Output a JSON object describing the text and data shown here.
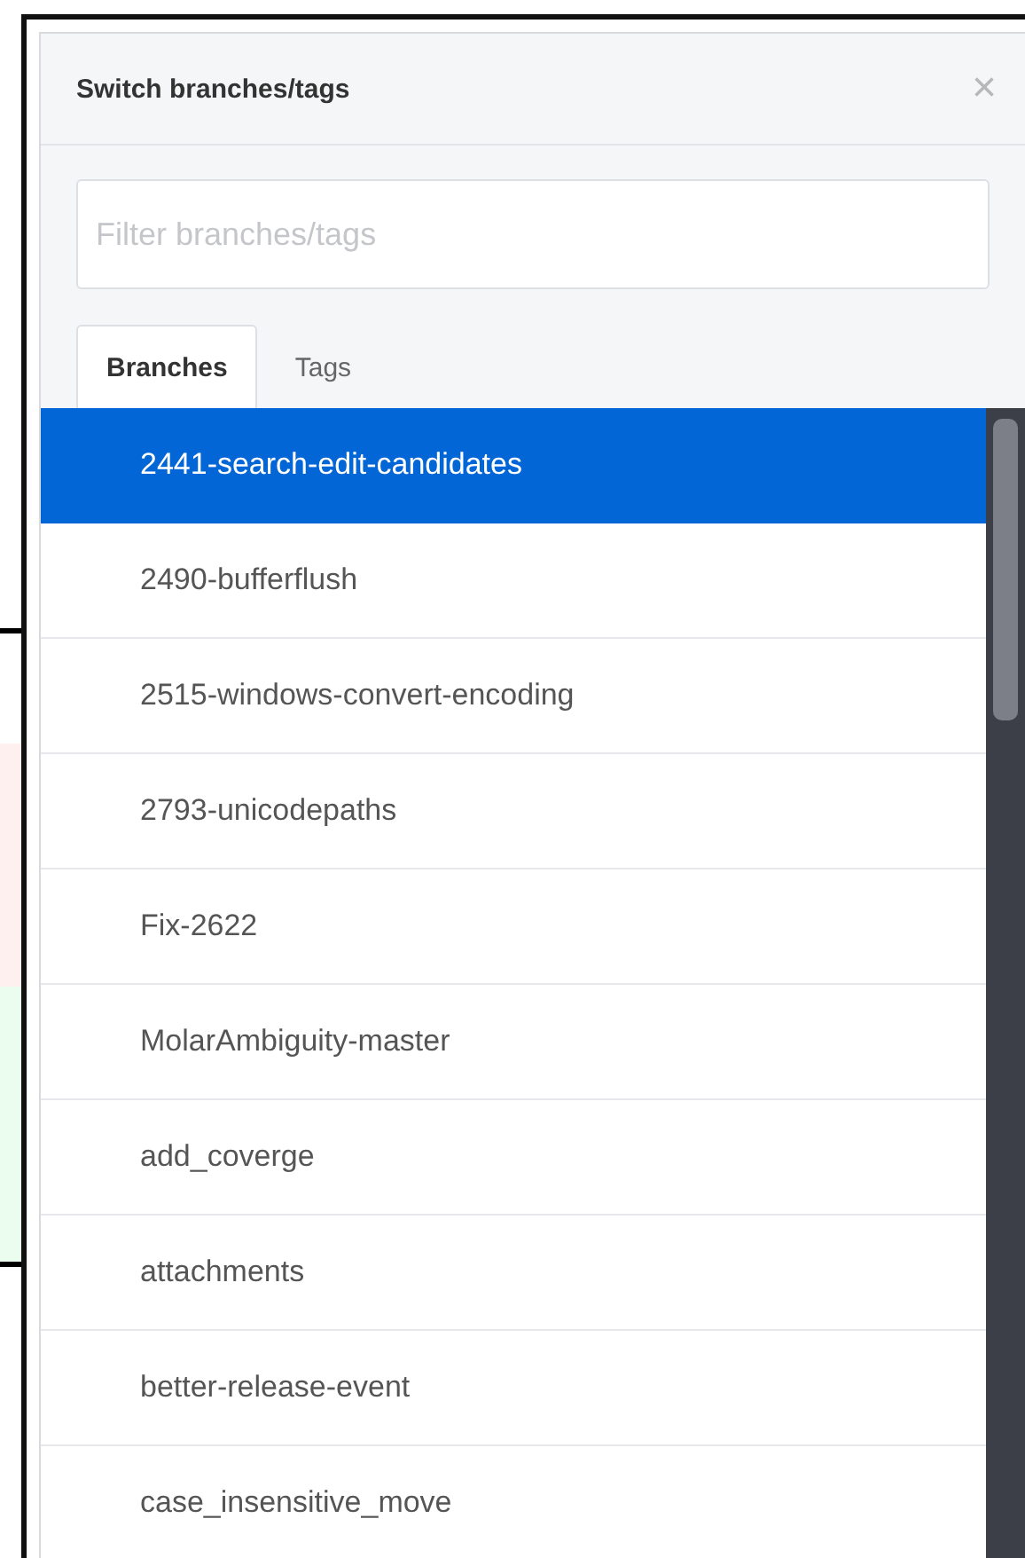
{
  "dialog": {
    "title": "Switch branches/tags",
    "close": "×"
  },
  "filter": {
    "placeholder": "Filter branches/tags"
  },
  "tabs": [
    {
      "label": "Branches",
      "selected": true
    },
    {
      "label": "Tags",
      "selected": false
    }
  ],
  "branches": [
    {
      "name": "2441-search-edit-candidates",
      "selected": true
    },
    {
      "name": "2490-bufferflush",
      "selected": false
    },
    {
      "name": "2515-windows-convert-encoding",
      "selected": false
    },
    {
      "name": "2793-unicodepaths",
      "selected": false
    },
    {
      "name": "Fix-2622",
      "selected": false
    },
    {
      "name": "MolarAmbiguity-master",
      "selected": false
    },
    {
      "name": "add_coverge",
      "selected": false
    },
    {
      "name": "attachments",
      "selected": false
    },
    {
      "name": "better-release-event",
      "selected": false
    },
    {
      "name": "case_insensitive_move",
      "selected": false
    }
  ]
}
